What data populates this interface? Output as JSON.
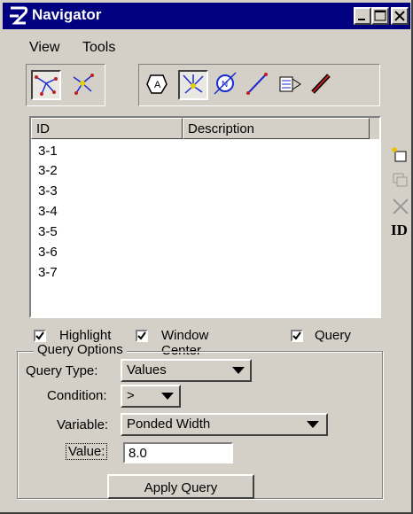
{
  "window": {
    "title": "Navigator"
  },
  "menu": [
    "View",
    "Tools"
  ],
  "list": {
    "columns": [
      "ID",
      "Description"
    ],
    "rows": [
      {
        "id": "3-1",
        "description": ""
      },
      {
        "id": "3-2",
        "description": ""
      },
      {
        "id": "3-3",
        "description": ""
      },
      {
        "id": "3-4",
        "description": ""
      },
      {
        "id": "3-5",
        "description": ""
      },
      {
        "id": "3-6",
        "description": ""
      },
      {
        "id": "3-7",
        "description": ""
      }
    ]
  },
  "side_tools": {
    "id_label": "ID"
  },
  "checkboxes": [
    {
      "label": "Highlight",
      "checked": true
    },
    {
      "label": "Window Center",
      "checked": true
    },
    {
      "label": "Query",
      "checked": true
    }
  ],
  "query_options": {
    "title": "Query Options",
    "query_type_label": "Query Type:",
    "query_type_value": "Values",
    "condition_label": "Condition:",
    "condition_value": ">",
    "variable_label": "Variable:",
    "variable_value": "Ponded Width",
    "value_label": "Value:",
    "value": "8.0",
    "apply_label": "Apply Query"
  },
  "colors": {
    "title_bar": "#000080",
    "face": "#d4d0c8"
  }
}
